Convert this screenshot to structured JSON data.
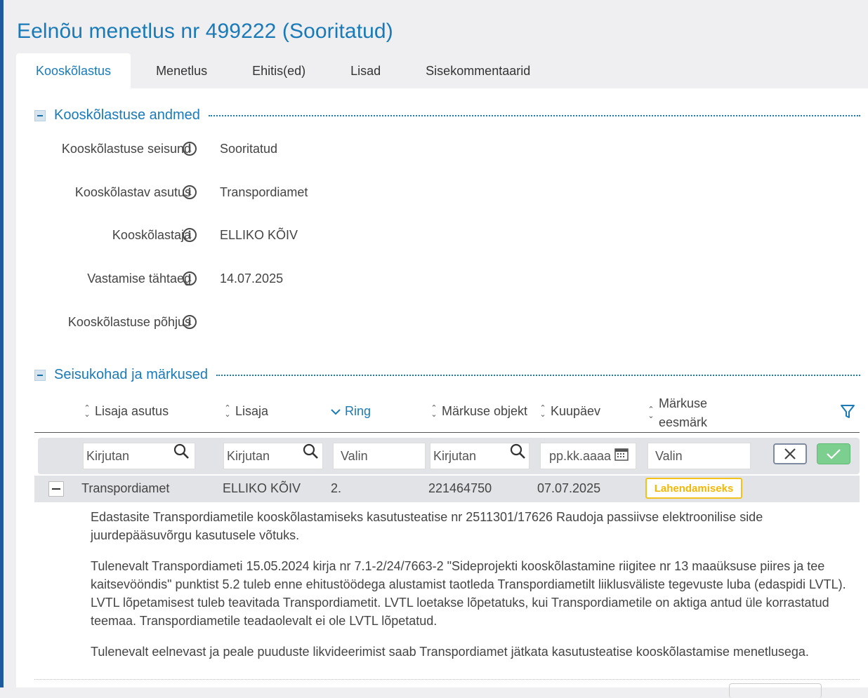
{
  "page": {
    "title": "Eelnõu menetlus nr 499222 (Sooritatud)"
  },
  "tabs": [
    {
      "label": "Kooskõlastus",
      "active": true
    },
    {
      "label": "Menetlus",
      "active": false
    },
    {
      "label": "Ehitis(ed)",
      "active": false
    },
    {
      "label": "Lisad",
      "active": false
    },
    {
      "label": "Sisekommentaarid",
      "active": false
    }
  ],
  "section1": {
    "title": "Kooskõlastuse andmed",
    "fields": [
      {
        "label": "Kooskõlastuse seisund",
        "value": "Sooritatud"
      },
      {
        "label": "Kooskõlastav asutus",
        "value": "Transpordiamet"
      },
      {
        "label": "Kooskõlastaja",
        "value": "ELLIKO KÕIV"
      },
      {
        "label": "Vastamise tähtaeg",
        "value": "14.07.2025"
      },
      {
        "label": "Kooskõlastuse põhjus",
        "value": ""
      }
    ]
  },
  "section2": {
    "title": "Seisukohad ja märkused",
    "columns": [
      {
        "label": "Lisaja asutus"
      },
      {
        "label": "Lisaja"
      },
      {
        "label": "Ring"
      },
      {
        "label": "Märkuse objekt"
      },
      {
        "label": "Kuupäev"
      },
      {
        "label_line1": "Märkuse",
        "label_line2": "eesmärk"
      }
    ],
    "filters": {
      "lisaja_asutus": "Kirjutan",
      "lisaja": "Kirjutan",
      "ring": "Valin",
      "objekt": "Kirjutan",
      "kuupaev": "pp.kk.aaaa",
      "eesmark": "Valin"
    },
    "row": {
      "asutus": "Transpordiamet",
      "lisaja": "ELLIKO KÕIV",
      "ring": "2.",
      "objekt": "221464750",
      "kuupaev": "07.07.2025",
      "eesmark": "Lahendamiseks"
    },
    "paragraphs": [
      "Edastasite Transpordiametile kooskõlastamiseks kasutusteatise nr 2511301/17626 Raudoja passiivse elektroonilise side juurdepääsuvõrgu kasutusele võtuks.",
      "Tulenevalt Transpordiameti 15.05.2024 kirja nr 7.1-2/24/7663-2 \"Sideprojekti kooskõlastamine riigitee nr 13 maaüksuse piires ja tee kaitsevööndis\" punktist 5.2 tuleb enne ehitustöödega alustamist taotleda Transpordiametilt liiklusväliste tegevuste luba (edaspidi LVTL). LVTL lõpetamisest tuleb teavitada Transpordiametit. LVTL loetakse lõpetatuks, kui Transpordiametile on aktiga antud üle korrastatud teemaa. Transpordiametile teadaolevalt ei ole LVTL lõpetatud.",
      "Tulenevalt eelnevast ja peale puuduste likvideerimist saab Transpordiamet jätkata kasutusteatise kooskõlastamise menetlusega."
    ]
  },
  "colors": {
    "accent": "#1a7ab8",
    "badge": "#f2c21b",
    "confirm": "#7dcf8f"
  }
}
